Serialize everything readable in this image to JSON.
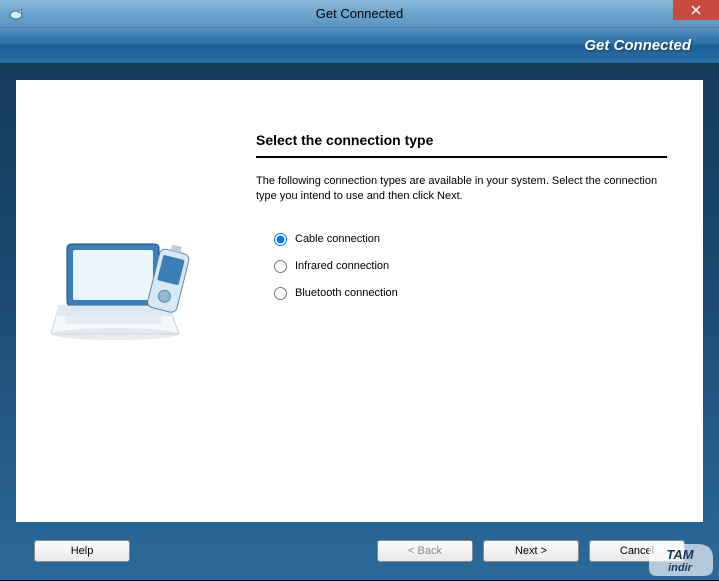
{
  "titlebar": {
    "title": "Get Connected"
  },
  "header": {
    "title": "Get Connected"
  },
  "content": {
    "heading": "Select the connection type",
    "instruction": "The following connection types are available in your system. Select the connection type you intend to use and then click Next.",
    "options": [
      {
        "label": "Cable connection",
        "checked": true
      },
      {
        "label": "Infrared connection",
        "checked": false
      },
      {
        "label": "Bluetooth connection",
        "checked": false
      }
    ]
  },
  "buttons": {
    "help": "Help",
    "back": "< Back",
    "next": "Next >",
    "cancel": "Cancel"
  },
  "watermark": {
    "line1": "TAM",
    "line2": "indir"
  }
}
